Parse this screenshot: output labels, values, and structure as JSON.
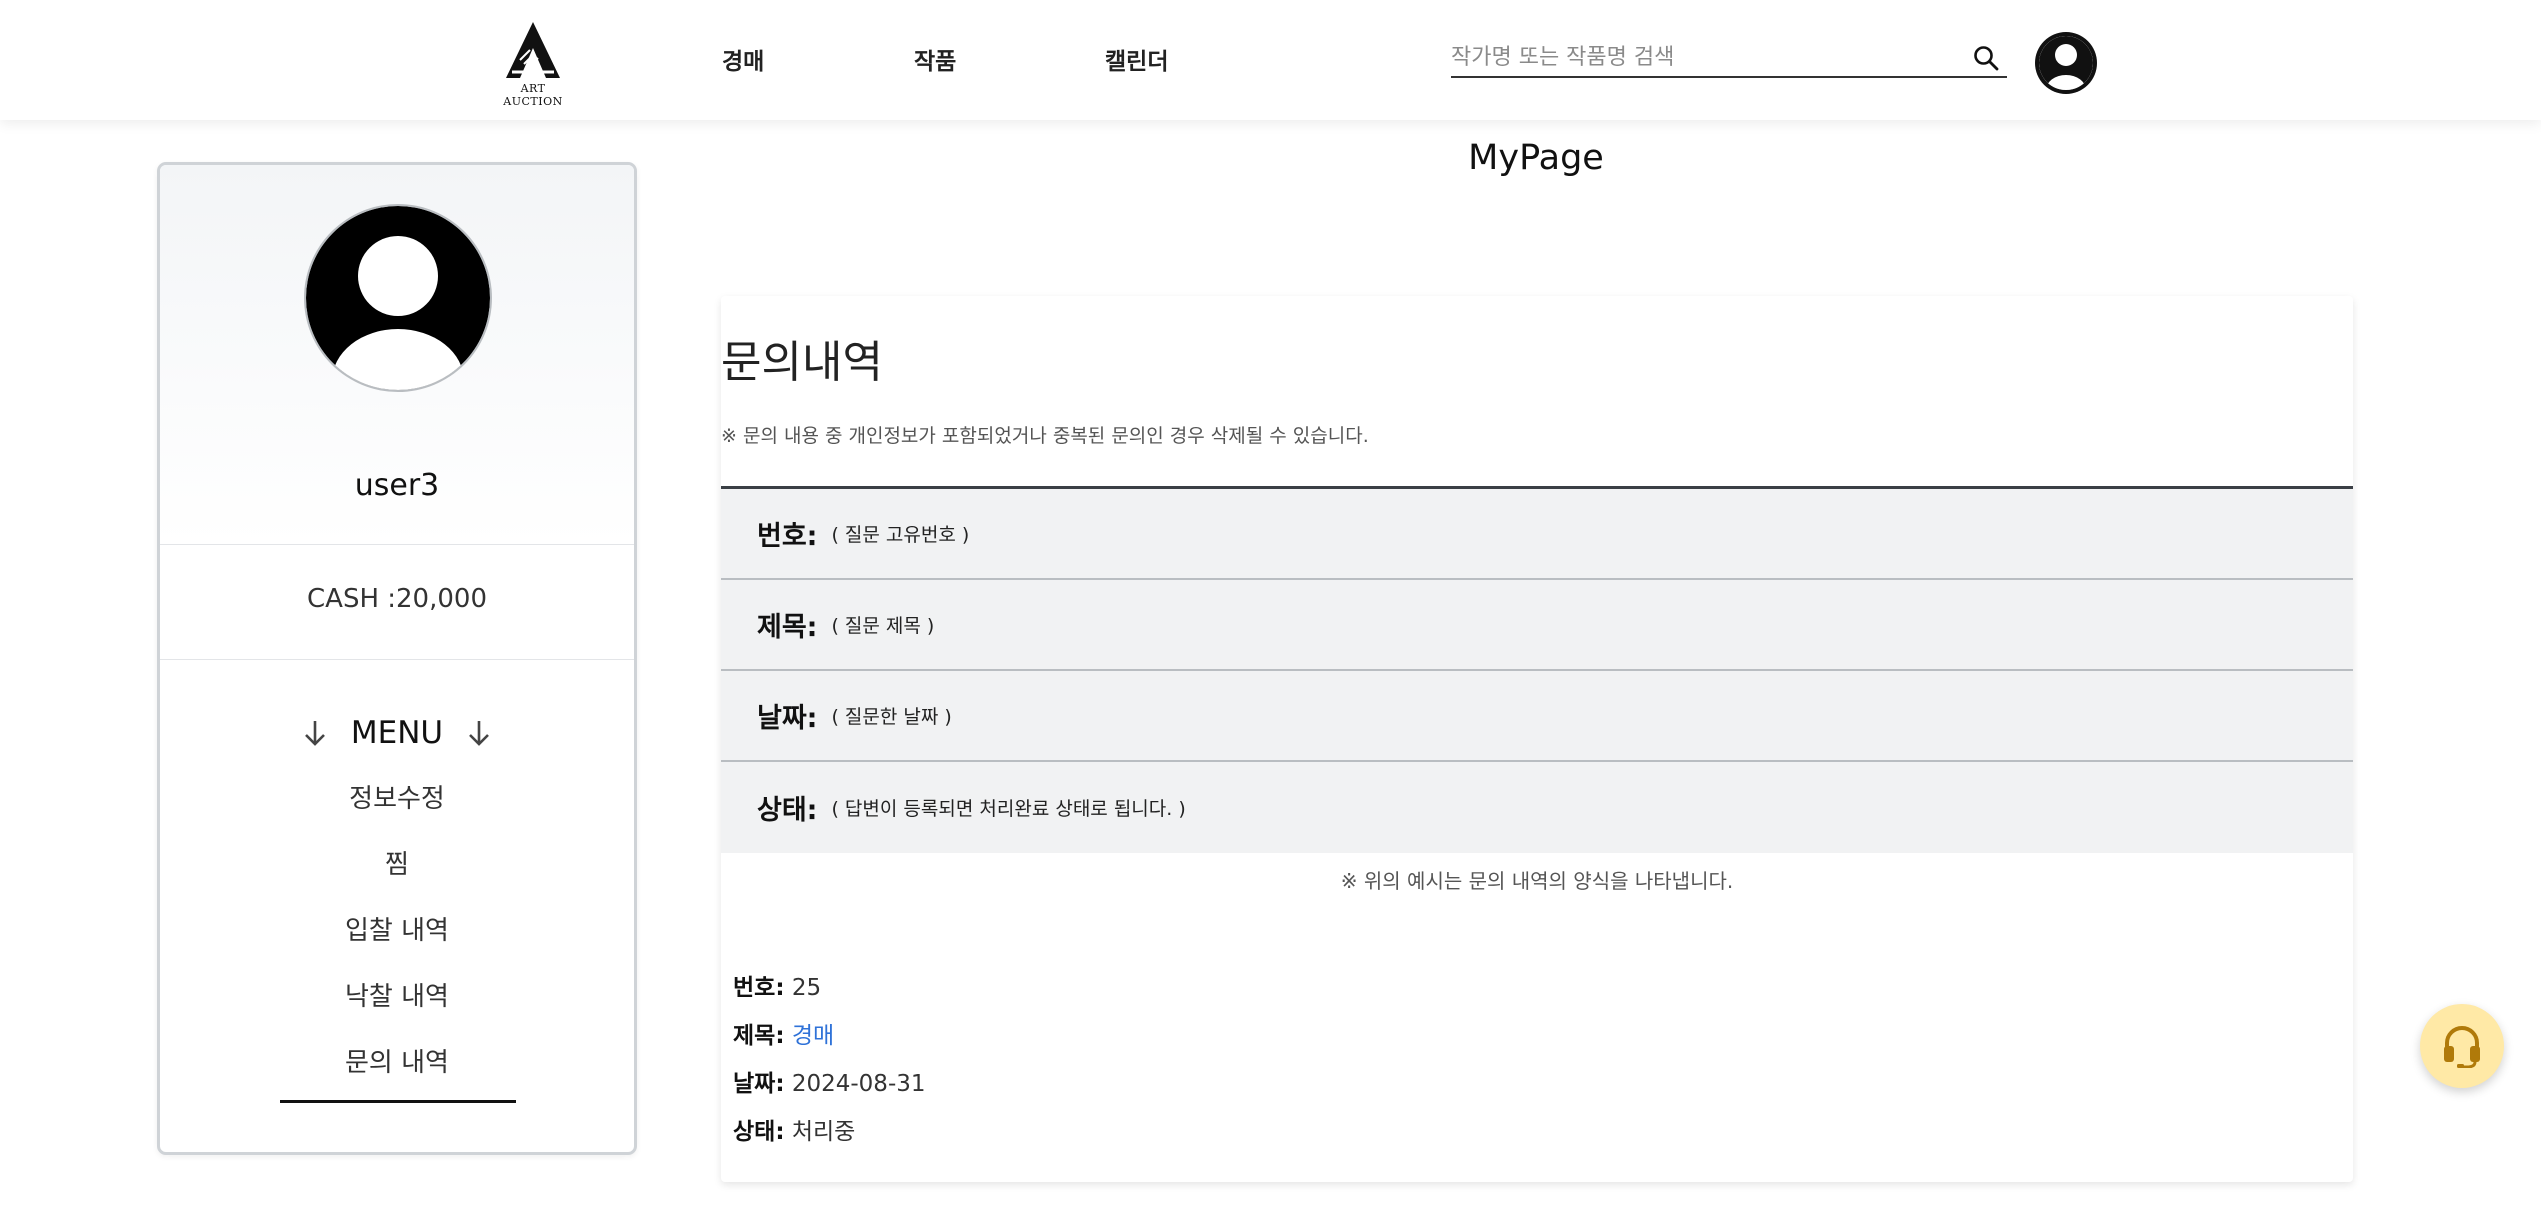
{
  "header": {
    "logo_text": "ART AUCTION",
    "nav": [
      "경매",
      "작품",
      "캘린더"
    ],
    "search_placeholder": "작가명 또는 작품명 검색"
  },
  "sidebar": {
    "username": "user3",
    "cash": "CASH :20,000",
    "menu_title": "MENU",
    "menu_items": [
      "정보수정",
      "찜",
      "입찰 내역",
      "낙찰 내역",
      "문의 내역"
    ],
    "active_item": "문의 내역"
  },
  "main": {
    "page_title": "MyPage",
    "heading": "문의내역",
    "notice": "※ 문의 내용 중 개인정보가 포함되었거나 중복된 문의인 경우 삭제될 수 있습니다.",
    "format_rows": [
      {
        "key": "번호:",
        "value": "( 질문 고유번호 )"
      },
      {
        "key": "제목:",
        "value": "( 질문 제목 )"
      },
      {
        "key": "날짜:",
        "value": "( 질문한 날짜 )"
      },
      {
        "key": "상태:",
        "value": "( 답변이 등록되면 처리완료 상태로 됩니다. )"
      }
    ],
    "example_note": "※ 위의 예시는 문의 내역의 양식을 나타냅니다.",
    "entry": {
      "number_label": "번호:",
      "number": "25",
      "title_label": "제목:",
      "title": "경매",
      "date_label": "날짜:",
      "date": "2024-08-31",
      "status_label": "상태:",
      "status": "처리중"
    }
  },
  "colors": {
    "link": "#2f72d8",
    "support_button": "#ffe9a6",
    "table_row_bg": "#f1f2f3"
  },
  "icons": {
    "logo": "art-auction-logo",
    "search": "search-icon",
    "profile": "user-circle-icon",
    "menu_arrows": "arrow-down-icon",
    "support": "headset-icon"
  }
}
